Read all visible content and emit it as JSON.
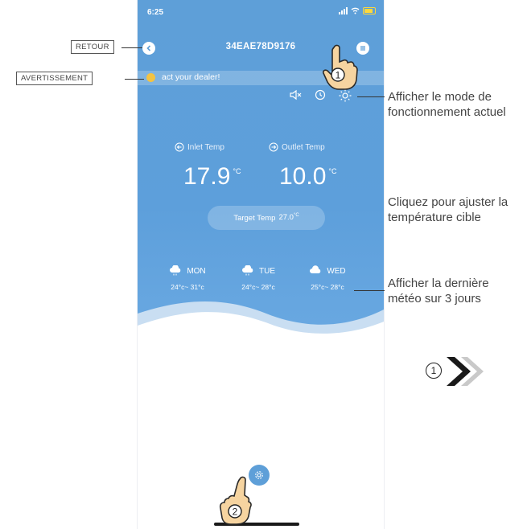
{
  "status_bar": {
    "time": "6:25"
  },
  "header": {
    "title": "34EAE78D9176"
  },
  "warning": {
    "text": "act your dealer!"
  },
  "inlet": {
    "label": "Inlet Temp",
    "value": "17.9",
    "unit": "°C"
  },
  "outlet": {
    "label": "Outlet Temp",
    "value": "10.0",
    "unit": "°C"
  },
  "target": {
    "label": "Target Temp",
    "value": "27.0",
    "unit": "°C"
  },
  "weather": [
    {
      "day": "MON",
      "range": "24°c~ 31°c"
    },
    {
      "day": "TUE",
      "range": "24°c~ 28°c"
    },
    {
      "day": "WED",
      "range": "25°c~ 28°c"
    }
  ],
  "annotations": {
    "back": "RETOUR",
    "warning": "AVERTISSEMENT",
    "mode": "Afficher le mode de fonctionnement actuel",
    "target": "Cliquez pour ajuster la température cible",
    "weather": "Afficher la dernière météo sur 3 jours",
    "step1": "1",
    "step2": "2",
    "step_nav": "1"
  },
  "colors": {
    "app_blue": "#5e9fd8",
    "warning_yellow": "#f3c343"
  }
}
